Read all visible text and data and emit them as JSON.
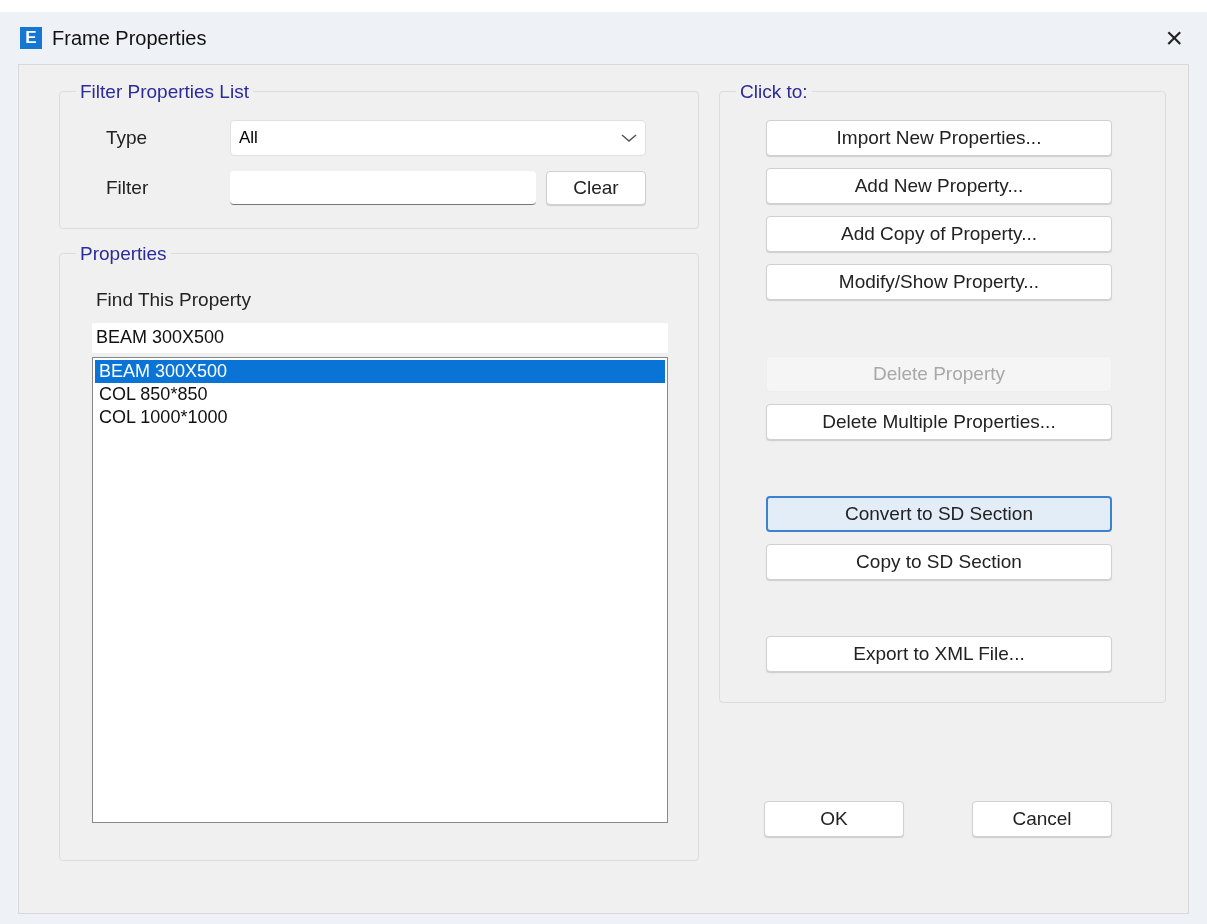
{
  "window": {
    "title": "Frame Properties",
    "icon_letter": "E",
    "close": "×"
  },
  "filter_group": {
    "title": "Filter Properties List",
    "type_label": "Type",
    "type_value": "All",
    "filter_label": "Filter",
    "clear_button": "Clear"
  },
  "properties_group": {
    "title": "Properties",
    "find_label": "Find This Property",
    "find_value": "BEAM 300X500",
    "items": [
      {
        "label": "BEAM 300X500",
        "selected": true
      },
      {
        "label": "COL 850*850",
        "selected": false
      },
      {
        "label": "COL 1000*1000",
        "selected": false
      }
    ]
  },
  "actions_group": {
    "title": "Click to:",
    "button_groups": [
      [
        {
          "label": "Import New Properties...",
          "disabled": false,
          "focused": false
        },
        {
          "label": "Add New Property...",
          "disabled": false,
          "focused": false
        },
        {
          "label": "Add Copy of Property...",
          "disabled": false,
          "focused": false
        },
        {
          "label": "Modify/Show Property...",
          "disabled": false,
          "focused": false
        }
      ],
      [
        {
          "label": "Delete Property",
          "disabled": true,
          "focused": false
        },
        {
          "label": "Delete Multiple Properties...",
          "disabled": false,
          "focused": false
        }
      ],
      [
        {
          "label": "Convert to SD Section",
          "disabled": false,
          "focused": true
        },
        {
          "label": "Copy to SD Section",
          "disabled": false,
          "focused": false
        }
      ],
      [
        {
          "label": "Export to XML File...",
          "disabled": false,
          "focused": false
        }
      ]
    ]
  },
  "footer": {
    "ok": "OK",
    "cancel": "Cancel"
  }
}
